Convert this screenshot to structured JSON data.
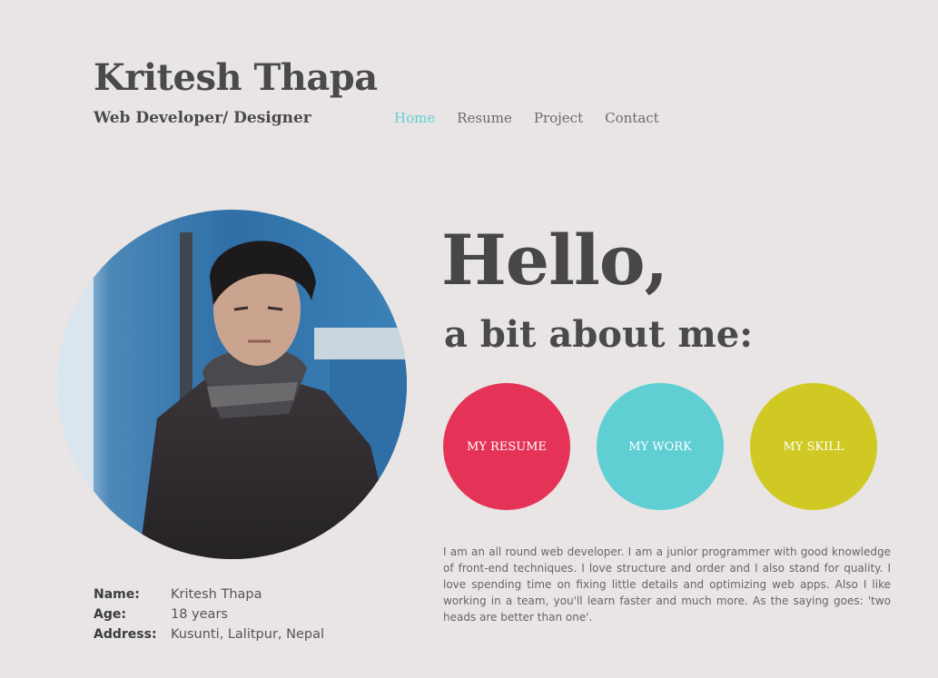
{
  "header": {
    "name": "Kritesh Thapa",
    "role": "Web Developer/ Designer"
  },
  "nav": {
    "items": [
      {
        "label": "Home",
        "active": true
      },
      {
        "label": "Resume",
        "active": false
      },
      {
        "label": "Project",
        "active": false
      },
      {
        "label": "Contact",
        "active": false
      }
    ]
  },
  "hero": {
    "greeting": "Hello,",
    "subtitle": "a bit about me:"
  },
  "buttons": {
    "resume": "MY RESUME",
    "work": "MY WORK",
    "skill": "MY SKILL"
  },
  "bio": "I am an all round web developer. I am a junior programmer with good knowledge of front-end techniques. I love structure and order and I also stand for quality. I love spending time on fixing little details and optimizing web apps. Also I like working in a team, you'll learn faster and much more. As the saying goes: 'two heads are better than one'.",
  "info": {
    "name_label": "Name:",
    "name_value": "Kritesh Thapa",
    "age_label": "Age:",
    "age_value": "18 years",
    "address_label": "Address:",
    "address_value": "Kusunti, Lalitpur, Nepal"
  },
  "colors": {
    "background": "#e8e5e4",
    "accent_teal": "#5fcfd4",
    "accent_red": "#e53358",
    "accent_yellow": "#d0c923",
    "text_dark": "#4a4a4a"
  }
}
